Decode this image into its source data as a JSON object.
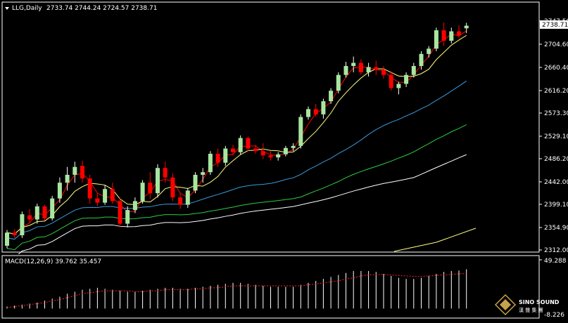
{
  "chart_header": {
    "symbol_title": "LLG,Daily",
    "ohlc_text": "2733.74 2744.24 2724.57 2738.71"
  },
  "price_axis": {
    "ticks": [
      "2747.50",
      "2704.60",
      "2660.40",
      "2616.20",
      "2573.30",
      "2529.10",
      "2486.20",
      "2442.00",
      "2399.10",
      "2354.90",
      "2312.00"
    ],
    "current_price_label": "2738.71"
  },
  "indicator": {
    "title": "MACD(12,26,9) 39.762 35.457",
    "scale_top": "49.288",
    "scale_bottom": "-8.226"
  },
  "watermark": {
    "line1": "SINO SOUND",
    "line2": "漢 聲 集 團"
  },
  "colors": {
    "background": "#000000",
    "frame": "#ffffff",
    "bull_candle": "#a8e6a0",
    "bear_candle": "#ff0000",
    "ma_red": "#ff0000",
    "ma_yellow": "#ffff80",
    "ma_blue": "#3a9ad9",
    "ma_green": "#2ecc40",
    "ma_white": "#ffffff",
    "ma_long": "#ffff80",
    "macd_signal": "#ff2020"
  },
  "chart_data": {
    "type": "candlestick",
    "series_name": "LLG,Daily",
    "y_range": [
      2312.0,
      2747.5
    ],
    "last_ohlc": {
      "open": 2733.74,
      "high": 2744.24,
      "low": 2724.57,
      "close": 2738.71
    },
    "candles": [
      [
        2320,
        2350,
        2315,
        2345
      ],
      [
        2345,
        2352,
        2335,
        2340
      ],
      [
        2340,
        2385,
        2335,
        2380
      ],
      [
        2378,
        2390,
        2365,
        2370
      ],
      [
        2370,
        2400,
        2362,
        2395
      ],
      [
        2395,
        2398,
        2368,
        2372
      ],
      [
        2372,
        2415,
        2368,
        2410
      ],
      [
        2410,
        2450,
        2402,
        2440
      ],
      [
        2440,
        2470,
        2425,
        2455
      ],
      [
        2455,
        2480,
        2440,
        2470
      ],
      [
        2472,
        2482,
        2440,
        2448
      ],
      [
        2448,
        2455,
        2400,
        2410
      ],
      [
        2410,
        2420,
        2395,
        2402
      ],
      [
        2402,
        2435,
        2398,
        2428
      ],
      [
        2428,
        2440,
        2400,
        2405
      ],
      [
        2405,
        2412,
        2355,
        2362
      ],
      [
        2362,
        2395,
        2355,
        2388
      ],
      [
        2388,
        2412,
        2382,
        2405
      ],
      [
        2405,
        2445,
        2400,
        2440
      ],
      [
        2440,
        2460,
        2410,
        2420
      ],
      [
        2420,
        2475,
        2412,
        2468
      ],
      [
        2468,
        2480,
        2440,
        2450
      ],
      [
        2450,
        2458,
        2405,
        2412
      ],
      [
        2412,
        2420,
        2390,
        2398
      ],
      [
        2398,
        2430,
        2392,
        2425
      ],
      [
        2425,
        2460,
        2420,
        2455
      ],
      [
        2455,
        2468,
        2440,
        2460
      ],
      [
        2460,
        2500,
        2455,
        2495
      ],
      [
        2495,
        2505,
        2470,
        2478
      ],
      [
        2478,
        2510,
        2472,
        2505
      ],
      [
        2505,
        2512,
        2492,
        2498
      ],
      [
        2498,
        2530,
        2494,
        2525
      ],
      [
        2525,
        2528,
        2500,
        2505
      ],
      [
        2505,
        2512,
        2495,
        2500
      ],
      [
        2500,
        2515,
        2485,
        2492
      ],
      [
        2492,
        2500,
        2482,
        2488
      ],
      [
        2488,
        2498,
        2482,
        2494
      ],
      [
        2494,
        2510,
        2490,
        2506
      ],
      [
        2506,
        2515,
        2500,
        2510
      ],
      [
        2510,
        2570,
        2505,
        2565
      ],
      [
        2565,
        2585,
        2560,
        2580
      ],
      [
        2580,
        2590,
        2565,
        2570
      ],
      [
        2570,
        2600,
        2562,
        2595
      ],
      [
        2595,
        2620,
        2590,
        2615
      ],
      [
        2615,
        2650,
        2610,
        2645
      ],
      [
        2645,
        2670,
        2640,
        2662
      ],
      [
        2662,
        2680,
        2650,
        2668
      ],
      [
        2668,
        2675,
        2645,
        2650
      ],
      [
        2650,
        2668,
        2642,
        2660
      ],
      [
        2660,
        2672,
        2645,
        2655
      ],
      [
        2655,
        2662,
        2638,
        2645
      ],
      [
        2645,
        2652,
        2615,
        2620
      ],
      [
        2620,
        2632,
        2608,
        2628
      ],
      [
        2628,
        2650,
        2622,
        2645
      ],
      [
        2645,
        2668,
        2640,
        2662
      ],
      [
        2662,
        2690,
        2655,
        2685
      ],
      [
        2685,
        2700,
        2678,
        2695
      ],
      [
        2695,
        2735,
        2690,
        2730
      ],
      [
        2730,
        2745,
        2700,
        2710
      ],
      [
        2710,
        2735,
        2705,
        2728
      ],
      [
        2728,
        2740,
        2715,
        2720
      ],
      [
        2733.74,
        2744.24,
        2724.57,
        2738.71
      ]
    ],
    "macd_hist": [
      2,
      3,
      4,
      5,
      6,
      8,
      10,
      12,
      15,
      17,
      19,
      20,
      21,
      20,
      19,
      18,
      17,
      17,
      18,
      19,
      20,
      21,
      21,
      20,
      20,
      21,
      22,
      23,
      24,
      25,
      26,
      26,
      25,
      24,
      23,
      22,
      22,
      22,
      22,
      24,
      26,
      28,
      30,
      32,
      34,
      36,
      38,
      38,
      38,
      37,
      35,
      33,
      31,
      30,
      30,
      31,
      33,
      35,
      37,
      38,
      38.5,
      39.762
    ],
    "macd_signal": [
      1,
      2,
      3,
      4,
      5,
      6,
      8,
      9,
      11,
      13,
      15,
      16,
      17,
      18,
      18,
      18,
      18,
      17,
      17,
      18,
      18,
      19,
      19,
      19,
      19,
      20,
      20,
      21,
      21,
      22,
      23,
      23,
      23,
      23,
      23,
      23,
      23,
      23,
      23,
      23,
      24,
      25,
      26,
      27,
      28,
      30,
      31,
      33,
      34,
      34.5,
      34.5,
      34,
      33.5,
      33,
      32.5,
      32.5,
      33,
      33.5,
      34,
      34.5,
      35,
      35.457
    ],
    "macd_range": [
      -8.226,
      49.288
    ]
  }
}
